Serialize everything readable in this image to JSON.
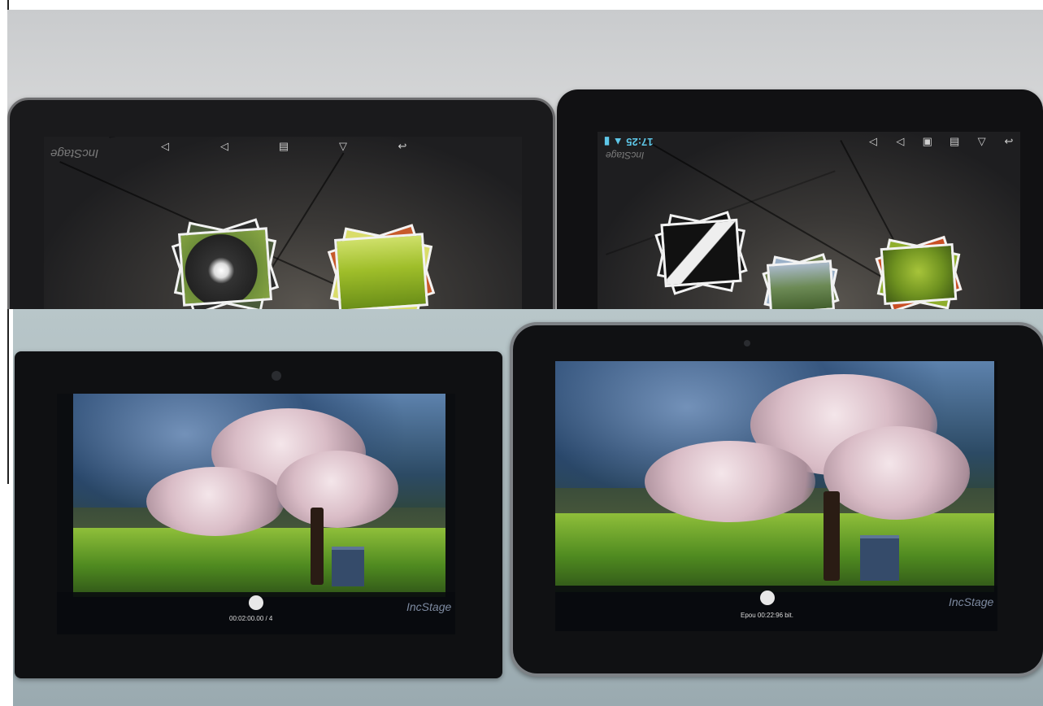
{
  "top_left_tablet": {
    "watermark": "IncStage",
    "nav_icons": [
      "speaker-low-icon",
      "speaker-high-icon",
      "recent-apps-icon",
      "home-icon",
      "back-icon"
    ]
  },
  "top_right_tablet": {
    "status_time": "17:25",
    "watermark": "IncStage",
    "nav_icons": [
      "speaker-low-icon",
      "speaker-high-icon",
      "screenshot-icon",
      "recent-apps-icon",
      "home-icon",
      "back-icon"
    ]
  },
  "bottom_left_tablet": {
    "player_time": "00:02:00.00 / 4",
    "brand": "IncStage"
  },
  "bottom_right_tablet": {
    "player_time": "Epou 00:22:96 bit.",
    "brand": "IncStage"
  }
}
